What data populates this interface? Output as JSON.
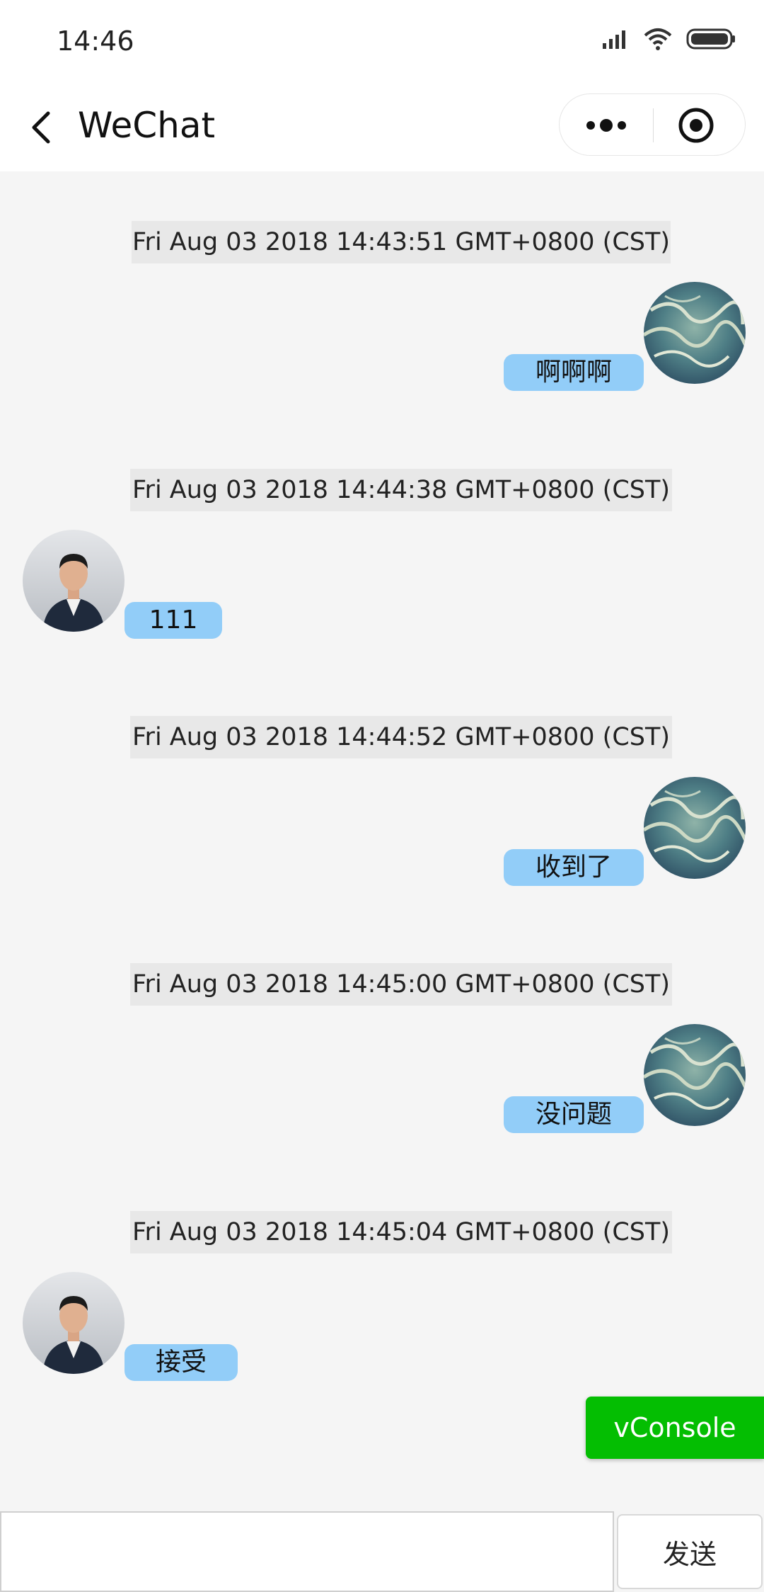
{
  "status_bar": {
    "time": "14:46",
    "icons": [
      "signal-icon",
      "wifi-icon",
      "battery-icon"
    ]
  },
  "nav": {
    "title": "WeChat",
    "back_icon": "chevron-left-icon",
    "more_icon": "more-dots-icon",
    "close_icon": "target-icon"
  },
  "messages": [
    {
      "timestamp": "Fri Aug 03 2018 14:43:51 GMT+0800 (CST)",
      "side": "right",
      "text": "啊啊啊",
      "avatar": "landscape-avatar"
    },
    {
      "timestamp": "Fri Aug 03 2018 14:44:38 GMT+0800 (CST)",
      "side": "left",
      "text": "111",
      "avatar": "person-avatar"
    },
    {
      "timestamp": "Fri Aug 03 2018 14:44:52 GMT+0800 (CST)",
      "side": "right",
      "text": "收到了",
      "avatar": "landscape-avatar"
    },
    {
      "timestamp": "Fri Aug 03 2018 14:45:00 GMT+0800 (CST)",
      "side": "right",
      "text": "没问题",
      "avatar": "landscape-avatar"
    },
    {
      "timestamp": "Fri Aug 03 2018 14:45:04 GMT+0800 (CST)",
      "side": "left",
      "text": "接受",
      "avatar": "person-avatar"
    }
  ],
  "vconsole": {
    "label": "vConsole"
  },
  "input_bar": {
    "input_value": "",
    "send_label": "发送"
  },
  "colors": {
    "bubble": "#92cdf8",
    "timestamp_bg": "#e8e8e8",
    "page_bg": "#f5f5f5",
    "vconsole_green": "#04be02"
  }
}
